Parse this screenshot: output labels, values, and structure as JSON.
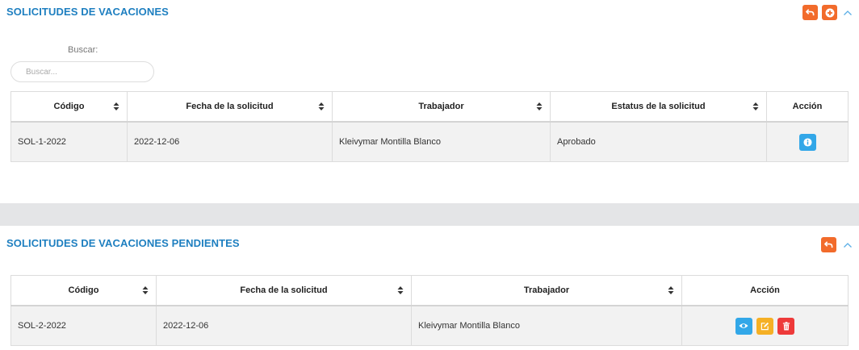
{
  "colors": {
    "title": "#1e7fc0",
    "orange": "#f26b2b",
    "info_blue": "#32a7e8",
    "edit_yellow": "#f5b025",
    "delete_red": "#ee3a3a"
  },
  "section1": {
    "title": "SOLICITUDES DE VACACIONES",
    "search_label": "Buscar:",
    "search_placeholder": "Buscar...",
    "headers": {
      "code": "Código",
      "date": "Fecha de la solicitud",
      "worker": "Trabajador",
      "status": "Estatus de la solicitud",
      "action": "Acción"
    },
    "rows": [
      {
        "code": "SOL-1-2022",
        "date": "2022-12-06",
        "worker": "Kleivymar Montilla Blanco",
        "status": "Aprobado"
      }
    ]
  },
  "section2": {
    "title": "SOLICITUDES DE VACACIONES PENDIENTES",
    "headers": {
      "code": "Código",
      "date": "Fecha de la solicitud",
      "worker": "Trabajador",
      "action": "Acción"
    },
    "rows": [
      {
        "code": "SOL-2-2022",
        "date": "2022-12-06",
        "worker": "Kleivymar Montilla Blanco"
      }
    ]
  }
}
